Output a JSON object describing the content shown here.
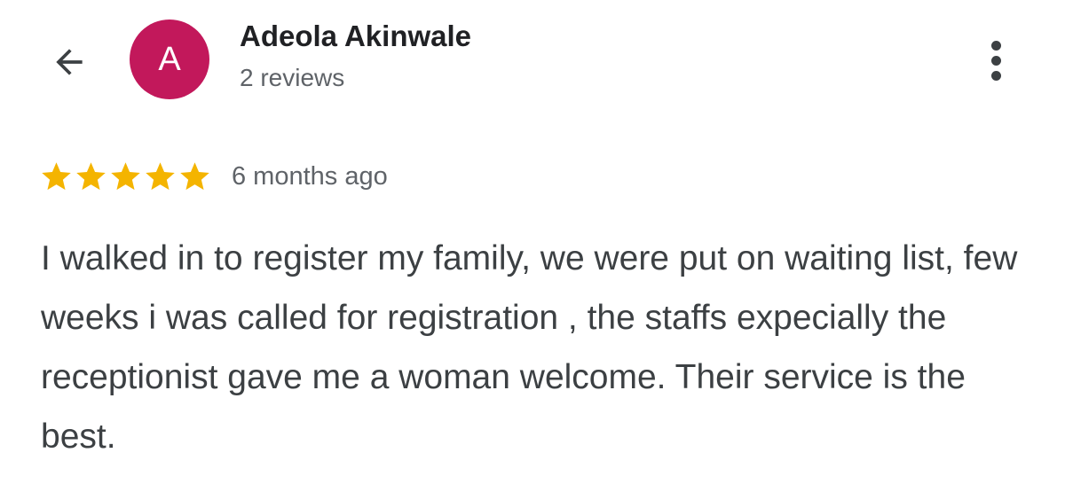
{
  "header": {
    "back_icon": "arrow-left-icon",
    "avatar_letter": "A",
    "avatar_color": "#c2185b",
    "author_name": "Adeola Akinwale",
    "review_count": "2 reviews",
    "menu_icon": "more-vert-icon"
  },
  "review": {
    "rating": 5,
    "max_rating": 5,
    "star_color": "#f4b400",
    "time_ago": "6 months ago",
    "text": "I walked in to register my family, we were put on waiting list, few weeks i was called for registration , the staffs expecially the receptionist gave me a woman welcome. Their service is the best."
  }
}
